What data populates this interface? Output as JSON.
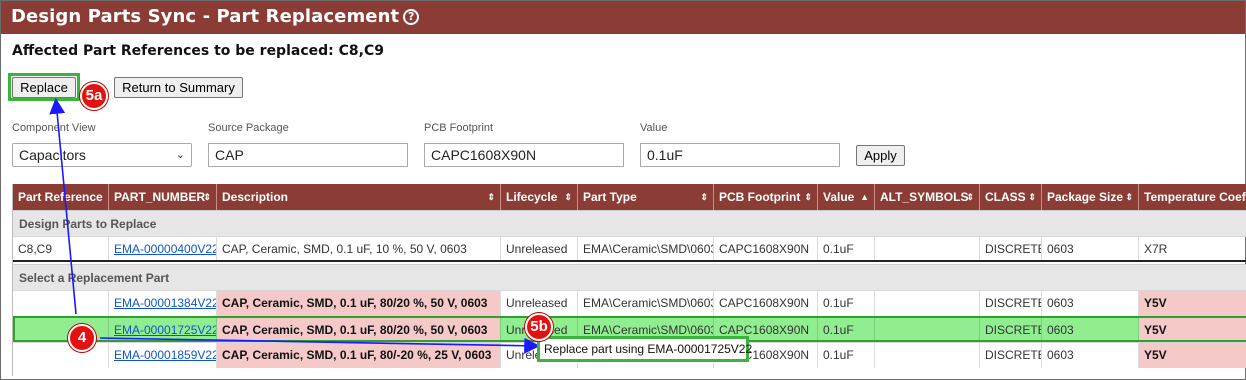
{
  "header": {
    "title": "Design Parts Sync - Part Replacement",
    "help_icon": "question-circle"
  },
  "affected_text": "Affected Part References to be replaced: C8,C9",
  "buttons": {
    "replace": "Replace",
    "return": "Return to Summary",
    "apply": "Apply"
  },
  "badges": {
    "step_5a": "5a",
    "step_5b": "5b",
    "step_4": "4"
  },
  "filters": {
    "component_view": {
      "label": "Component View",
      "value": "Capacitors"
    },
    "source_package": {
      "label": "Source Package",
      "value": "CAP"
    },
    "pcb_footprint": {
      "label": "PCB Footprint",
      "value": "CAPC1608X90N"
    },
    "value": {
      "label": "Value",
      "value": "0.1uF"
    }
  },
  "table": {
    "columns": [
      "Part Reference",
      "PART_NUMBER",
      "Description",
      "Lifecycle",
      "Part Type",
      "PCB Footprint",
      "Value",
      "ALT_SYMBOLS",
      "CLASS",
      "Package Size",
      "Temperature Coef"
    ],
    "group_replace": "Design Parts to Replace",
    "group_select": "Select a Replacement Part",
    "current_row": [
      "C8,C9",
      "EMA-00000400V22",
      "CAP, Ceramic, SMD, 0.1 uF, 10 %, 50 V, 0603",
      "Unreleased",
      "EMA\\Ceramic\\SMD\\0603",
      "CAPC1608X90N",
      "0.1uF",
      "",
      "DISCRETE",
      "0603",
      "X7R"
    ],
    "candidates": [
      [
        "",
        "EMA-00001384V22",
        "CAP, Ceramic, SMD, 0.1 uF, 80/20 %, 50 V, 0603",
        "Unreleased",
        "EMA\\Ceramic\\SMD\\0603",
        "CAPC1608X90N",
        "0.1uF",
        "",
        "DISCRETE",
        "0603",
        "Y5V"
      ],
      [
        "",
        "EMA-00001725V22",
        "CAP, Ceramic, SMD, 0.1 uF, 80/20 %, 50 V, 0603",
        "Unreleased",
        "EMA\\Ceramic\\SMD\\0603",
        "CAPC1608X90N",
        "0.1uF",
        "",
        "DISCRETE",
        "0603",
        "Y5V"
      ],
      [
        "",
        "EMA-00001859V22",
        "CAP, Ceramic, SMD, 0.1 uF, 80/-20 %, 25 V, 0603",
        "Unreleased",
        "EMA\\Ceramic\\SMD\\0603",
        "CAPC1608X90N",
        "0.1uF",
        "",
        "DISCRETE",
        "0603",
        "Y5V"
      ]
    ]
  },
  "tooltip": "Replace part using EMA-00001725V22",
  "colors": {
    "header": "#8b3d35",
    "highlight": "#90ee90",
    "highlight_border": "#2fa02f",
    "pink": "#f6c9c9",
    "badge": "#e3110f",
    "arrow": "#1a1aff",
    "link": "#1155cc"
  }
}
